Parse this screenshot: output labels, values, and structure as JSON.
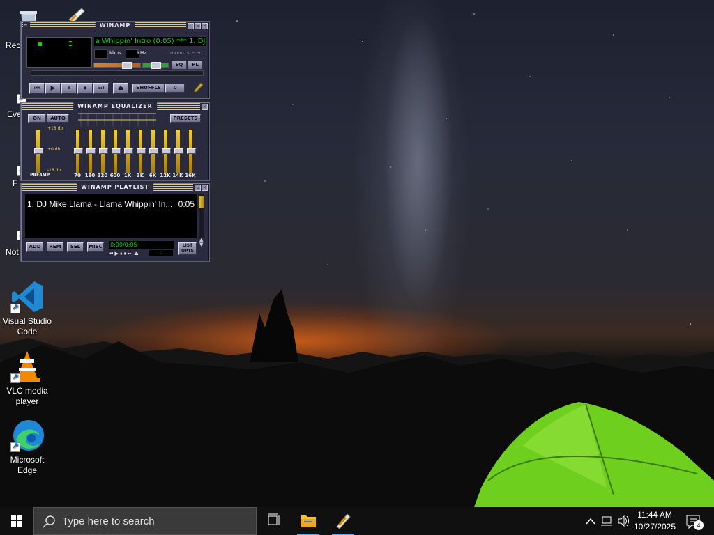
{
  "desktop": {
    "icons": [
      {
        "label": "Rec"
      },
      {
        "label": "Eve"
      },
      {
        "label": "F"
      },
      {
        "label": "Not"
      },
      {
        "label": "Visual Studio Code"
      },
      {
        "label": "VLC media player"
      },
      {
        "label": "Microsoft Edge"
      }
    ]
  },
  "winamp": {
    "main": {
      "title": "WINAMP",
      "marquee": "a Whippin' Intro (0:05) *** 1. DJ",
      "kbps_label": "kbps",
      "khz_label": "kHz",
      "mono_label": "mono",
      "stereo_label": "stereo",
      "eq_toggle": "EQ",
      "pl_toggle": "PL",
      "shuffle": "SHUFFLE",
      "transport": [
        "prev",
        "play",
        "pause",
        "stop",
        "next"
      ]
    },
    "equalizer": {
      "title": "WINAMP EQUALIZER",
      "on_label": "ON",
      "auto_label": "AUTO",
      "presets_label": "PRESETS",
      "db_top": "+18 db",
      "db_mid": "+0 db",
      "db_bottom": "-18 db",
      "preamp_label": "PREAMP",
      "bands": [
        "70",
        "180",
        "320",
        "600",
        "1K",
        "3K",
        "6K",
        "12K",
        "14K",
        "16K"
      ]
    },
    "playlist": {
      "title": "WINAMP PLAYLIST",
      "items": [
        {
          "title": "1. DJ Mike Llama - Llama Whippin' In...",
          "duration": "0:05"
        }
      ],
      "add": "ADD",
      "rem": "REM",
      "sel": "SEL",
      "misc": "MISC",
      "list_opts": "LIST OPTS",
      "time_display": "0:00/0:05",
      "mini_counter": ":"
    }
  },
  "taskbar": {
    "search_placeholder": "Type here to search",
    "time": "11:44 AM",
    "date": "10/27/2025",
    "notifications": "4"
  },
  "colors": {
    "winamp_body": "#2b2b3f",
    "winamp_green": "#00e000",
    "eq_gold": "#e6c84a",
    "taskbar": "#101010",
    "accent": "#6aa7e8"
  }
}
